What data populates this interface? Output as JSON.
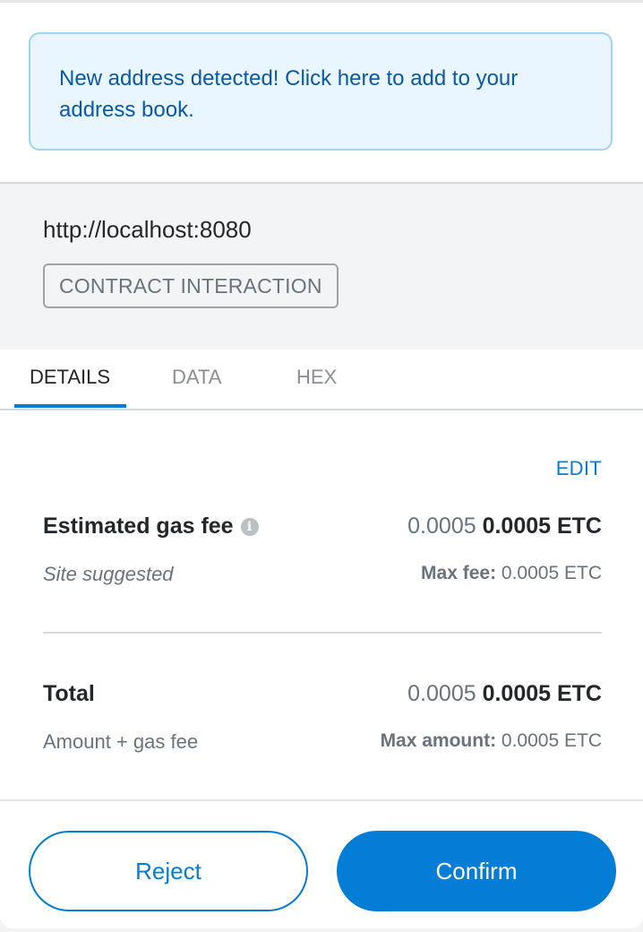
{
  "notice": {
    "text": "New address detected! Click here to add to your address book."
  },
  "origin": {
    "url": "http://localhost:8080",
    "badge": "CONTRACT INTERACTION"
  },
  "tabs": [
    {
      "label": "DETAILS",
      "active": true
    },
    {
      "label": "DATA",
      "active": false
    },
    {
      "label": "HEX",
      "active": false
    }
  ],
  "details": {
    "edit_label": "EDIT",
    "gas": {
      "label": "Estimated gas fee",
      "info_icon": "info-icon",
      "value_plain": "0.0005",
      "value_bold": "0.0005 ETC",
      "sub": "Site suggested",
      "max_label": "Max fee:",
      "max_value": "0.0005 ETC"
    },
    "total": {
      "label": "Total",
      "value_plain": "0.0005",
      "value_bold": "0.0005 ETC",
      "sub": "Amount + gas fee",
      "max_label": "Max amount:",
      "max_value": "0.0005 ETC"
    }
  },
  "footer": {
    "reject_label": "Reject",
    "confirm_label": "Confirm"
  },
  "colors": {
    "accent": "#037dd6",
    "notice_bg": "#eaf6ff",
    "notice_text": "#0b59a7"
  }
}
